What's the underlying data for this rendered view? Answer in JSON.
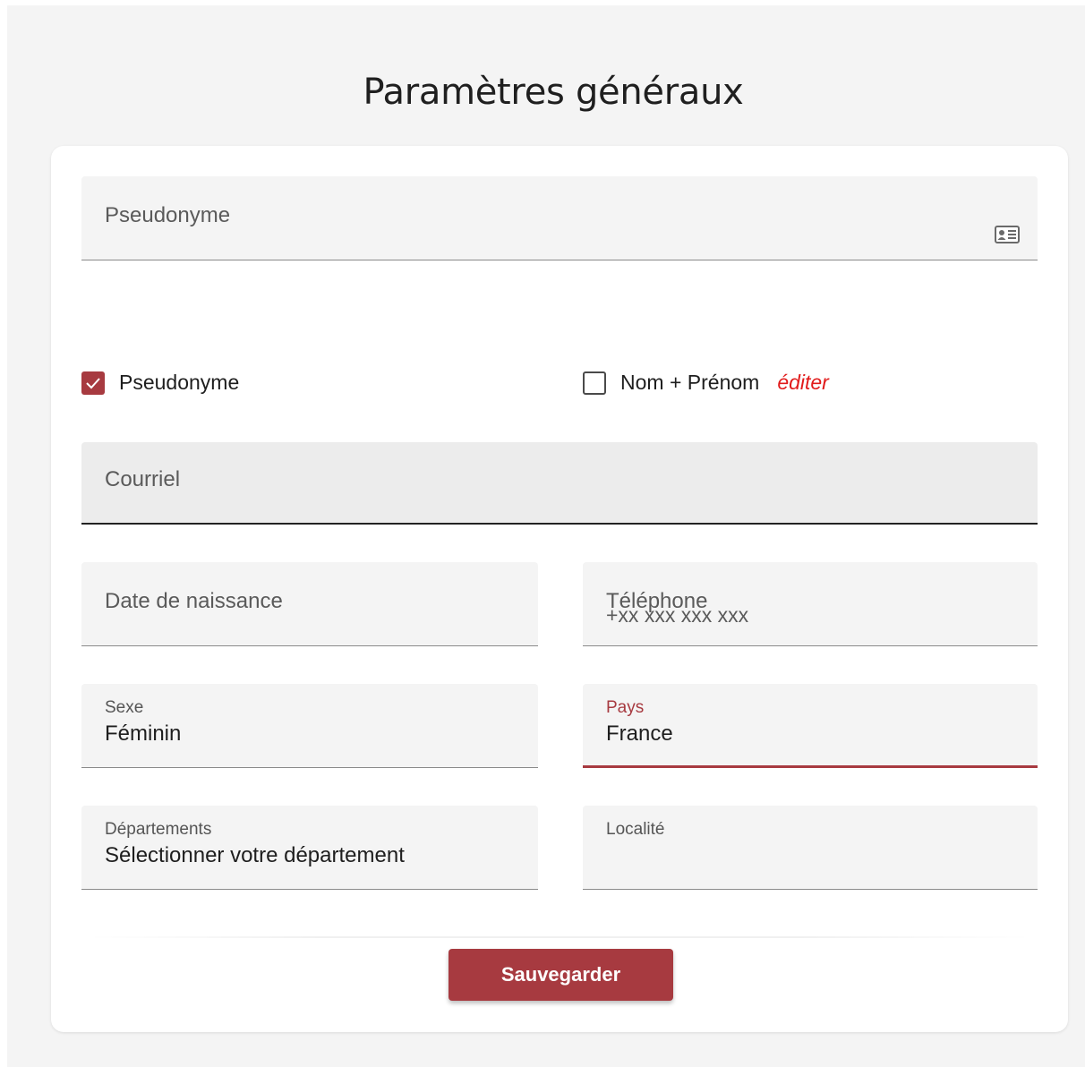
{
  "page": {
    "title": "Paramètres généraux"
  },
  "form": {
    "pseudonym_field": {
      "placeholder": "Pseudonyme",
      "icon": "id-card-icon"
    },
    "display_choice": {
      "pseudonym": {
        "label": "Pseudonyme",
        "checked": true
      },
      "full_name": {
        "label": "Nom + Prénom",
        "checked": false,
        "edit_label": "éditer"
      }
    },
    "email_field": {
      "placeholder": "Courriel"
    },
    "birthdate_field": {
      "placeholder": "Date de naissance"
    },
    "phone_field": {
      "label": "Téléphone",
      "placeholder": "+xx xxx xxx xxx"
    },
    "sex_field": {
      "label": "Sexe",
      "value": "Féminin"
    },
    "country_field": {
      "label": "Pays",
      "value": "France"
    },
    "department_field": {
      "label": "Départements",
      "value": "Sélectionner votre département"
    },
    "locality_field": {
      "label": "Localité",
      "value": ""
    },
    "save_label": "Sauvegarder"
  },
  "colors": {
    "accent": "#a73a40",
    "edit_link": "#e11b1b",
    "background": "#f4f4f4",
    "card": "#ffffff"
  }
}
